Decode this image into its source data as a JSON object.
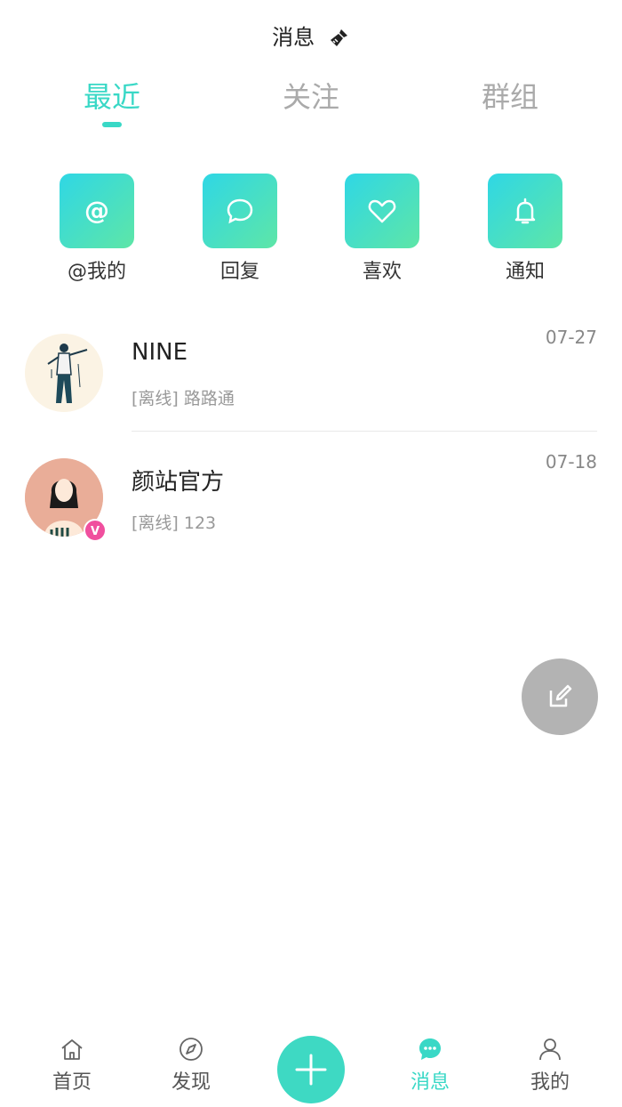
{
  "header": {
    "title": "消息",
    "clean_icon": "broom-icon"
  },
  "tabs": [
    {
      "label": "最近",
      "active": true
    },
    {
      "label": "关注",
      "active": false
    },
    {
      "label": "群组",
      "active": false
    }
  ],
  "shortcuts": [
    {
      "label": "@我的",
      "icon": "at-icon"
    },
    {
      "label": "回复",
      "icon": "chat-bubble-icon"
    },
    {
      "label": "喜欢",
      "icon": "heart-icon"
    },
    {
      "label": "通知",
      "icon": "bell-icon"
    }
  ],
  "messages": [
    {
      "name": "NINE",
      "preview": "[离线] 路路通",
      "time": "07-27"
    },
    {
      "name": "颜站官方",
      "preview": "[离线] 123",
      "time": "07-18",
      "badge": "V"
    }
  ],
  "fab": {
    "icon": "edit-icon"
  },
  "tabbar": [
    {
      "label": "首页",
      "icon": "home-icon"
    },
    {
      "label": "发现",
      "icon": "compass-icon"
    },
    {
      "label": "消息",
      "icon": "message-icon",
      "active": true
    },
    {
      "label": "我的",
      "icon": "user-icon"
    }
  ],
  "colors": {
    "accent": "#39d8c6",
    "fab": "#b3b3b3",
    "badge": "#f04f9e"
  }
}
